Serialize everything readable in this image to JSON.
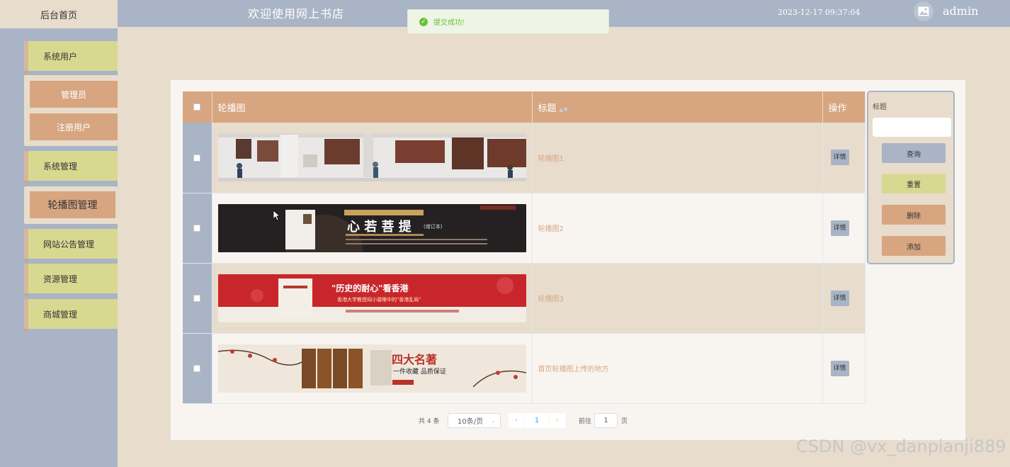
{
  "header": {
    "home_tab": "后台首页",
    "title": "欢迎使用网上书店",
    "datetime": "2023-12-17 09:37:04",
    "username": "admin"
  },
  "toast": {
    "message": "提交成功!"
  },
  "sidebar": {
    "items": [
      {
        "label": "系统用户"
      },
      {
        "label": "管理员"
      },
      {
        "label": "注册用户"
      },
      {
        "label": "系统管理"
      },
      {
        "label": "轮播图管理"
      },
      {
        "label": "网站公告管理"
      },
      {
        "label": "资源管理"
      },
      {
        "label": "商城管理"
      }
    ]
  },
  "table": {
    "headers": {
      "image": "轮播图",
      "title": "标题",
      "actions": "操作"
    },
    "rows": [
      {
        "title": "轮播图1",
        "action": "详情"
      },
      {
        "title": "轮播图2",
        "action": "详情"
      },
      {
        "title": "轮播图3",
        "action": "详情"
      },
      {
        "title": "首页轮播图上传的地方",
        "action": "详情"
      }
    ],
    "banners": [
      {
        "heading": "",
        "subheading": ""
      },
      {
        "heading": "心 若 菩 提",
        "subheading": "(增订本)"
      },
      {
        "heading": "\"历史的耐心\"看香港",
        "subheading": "香港大学教授阎小骏眼中的\"香港乱局\""
      },
      {
        "heading": "四大名著",
        "subheading": "一件收藏 品质保证"
      }
    ]
  },
  "search": {
    "label": "标题",
    "query_button": "查询",
    "reset_button": "重置",
    "delete_button": "删除",
    "add_button": "添加"
  },
  "pagination": {
    "total": "共 4 条",
    "page_size": "10条/页",
    "current_page": "1",
    "goto_prefix": "前往",
    "goto_value": "1",
    "goto_suffix": "页"
  },
  "watermark": "CSDN @vx_danpianji889",
  "colors": {
    "sidebar": "#a9b4c6",
    "accent": "#d7a680",
    "menu": "#d8d990",
    "page_bg": "#e8dccd",
    "success": "#67c23a"
  }
}
